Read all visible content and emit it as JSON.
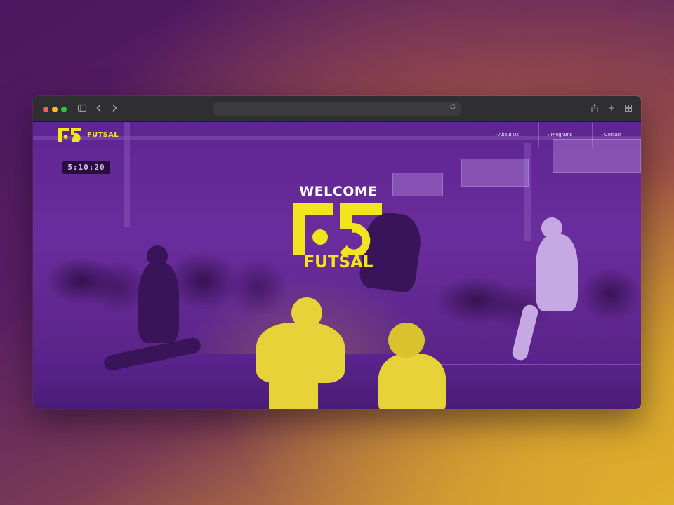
{
  "browser": {
    "address_value": "",
    "icons": [
      "sidebar-icon",
      "back-icon",
      "forward-icon",
      "reload-icon",
      "share-icon",
      "new-tab-icon",
      "tab-overview-icon"
    ]
  },
  "site": {
    "brand_text": "FUTSAL",
    "scoreboard": "5:10:20",
    "nav": [
      {
        "label": "About Us"
      },
      {
        "label": "Programs"
      },
      {
        "label": "Contact"
      }
    ],
    "hero": {
      "welcome": "WELCOME",
      "brand_word": "FUTSAL"
    }
  },
  "colors": {
    "accent_yellow": "#f2e51d",
    "overlay_purple": "#6a2d9d",
    "background_purple": "#4b1760",
    "background_gold": "#deb12d"
  }
}
